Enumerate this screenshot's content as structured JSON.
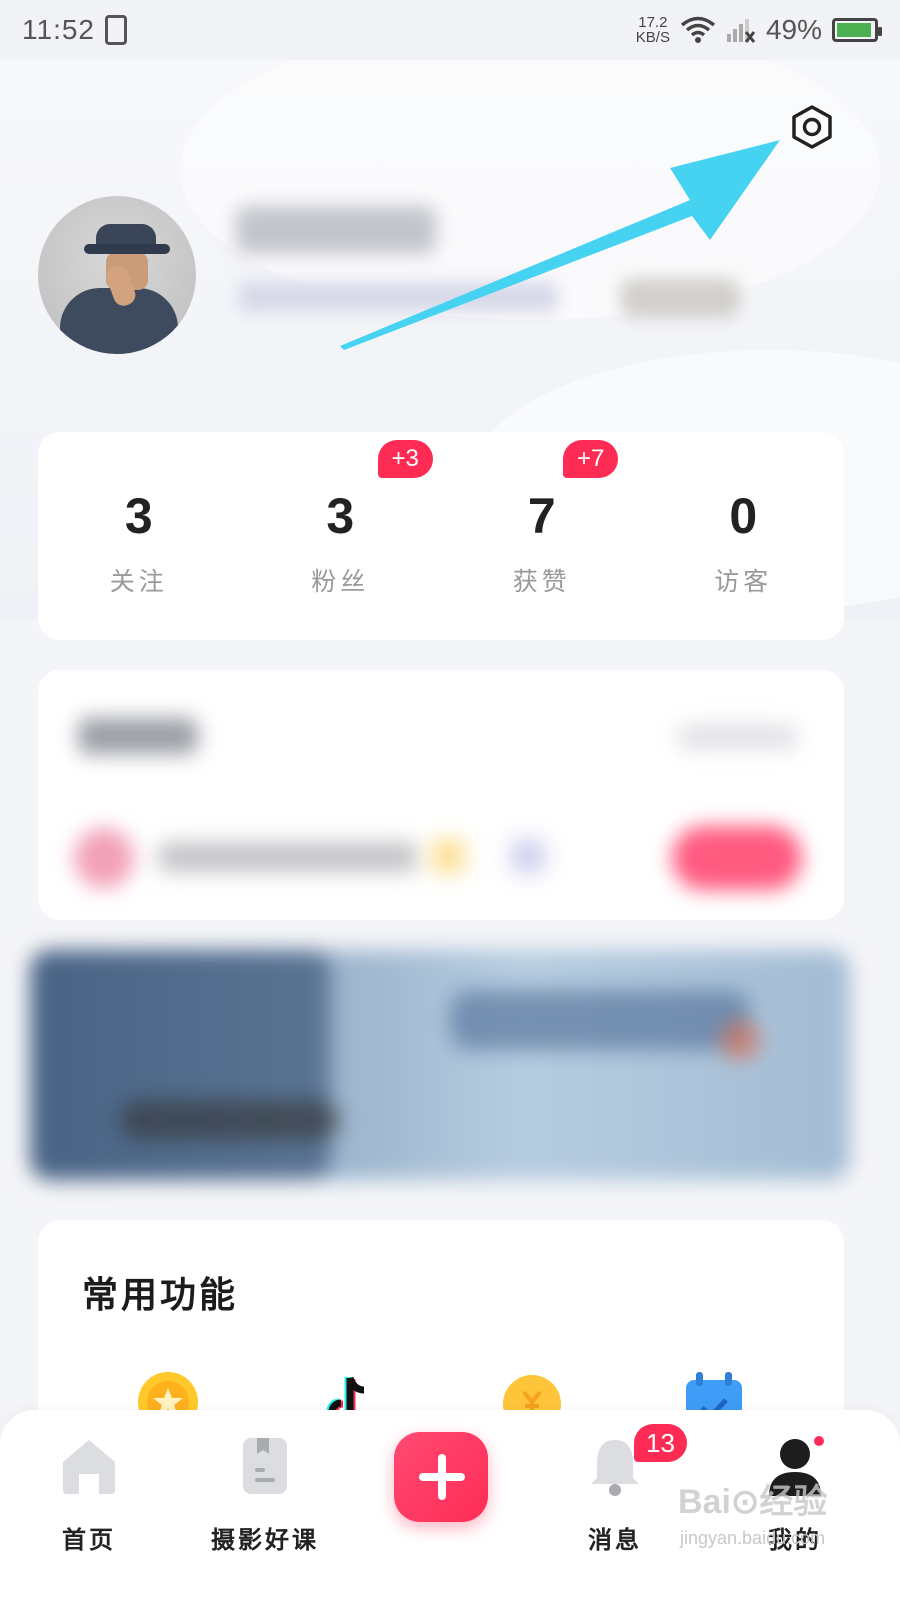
{
  "status_bar": {
    "time": "11:52",
    "net_speed_value": "17.2",
    "net_speed_unit": "KB/S",
    "battery": "49%",
    "icons": [
      "vibrate-icon",
      "wifi-icon",
      "signal-icon",
      "battery-icon"
    ]
  },
  "profile": {
    "settings_icon": "settings-icon",
    "avatar": "avatar",
    "name_blurred": true
  },
  "stats": [
    {
      "value": "3",
      "label": "关注",
      "badge": ""
    },
    {
      "value": "3",
      "label": "粉丝",
      "badge": "+3"
    },
    {
      "value": "7",
      "label": "获赞",
      "badge": "+7"
    },
    {
      "value": "0",
      "label": "访客",
      "badge": ""
    }
  ],
  "common": {
    "title": "常用功能",
    "icons": [
      "coin-icon",
      "tiktok-icon",
      "yen-coin-icon",
      "calendar-icon"
    ]
  },
  "tabbar": {
    "tabs": [
      {
        "label": "首页",
        "icon": "home-icon"
      },
      {
        "label": "摄影好课",
        "icon": "course-icon"
      },
      {
        "label": "",
        "icon": "plus-icon"
      },
      {
        "label": "消息",
        "icon": "bell-icon"
      },
      {
        "label": "我的",
        "icon": "profile-icon"
      }
    ],
    "message_badge": "13"
  },
  "watermark": {
    "main": "Bai⊙经验",
    "sub": "jingyan.baidu.com"
  },
  "colors": {
    "accent": "#fe2c55",
    "arrow": "#46d3f2",
    "background": "#f4f5f8"
  }
}
